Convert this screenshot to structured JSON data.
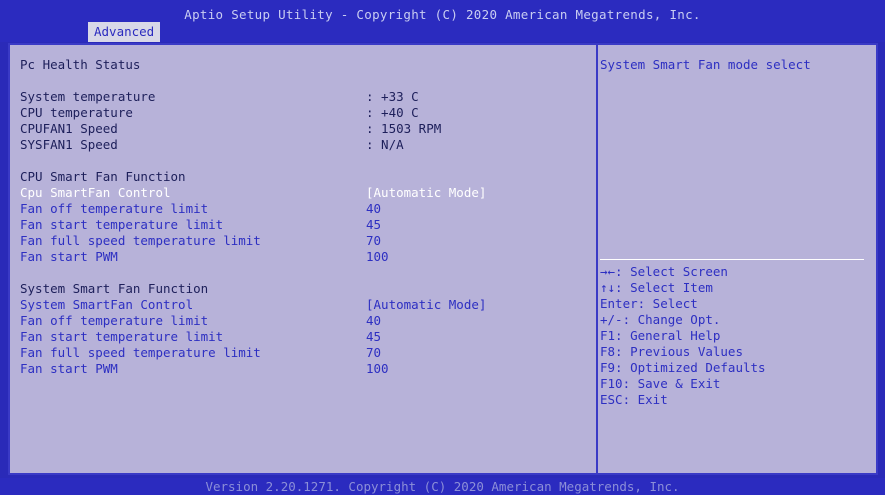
{
  "header": {
    "title": "Aptio Setup Utility - Copyright (C) 2020 American Megatrends, Inc.",
    "tab": "Advanced"
  },
  "page_title": "Pc Health Status",
  "monitor": [
    {
      "label": "System temperature",
      "value": ": +33 C"
    },
    {
      "label": "CPU temperature",
      "value": ": +40 C"
    },
    {
      "label": "CPUFAN1 Speed",
      "value": ": 1503 RPM"
    },
    {
      "label": "SYSFAN1 Speed",
      "value": ": N/A"
    }
  ],
  "cpu_fan": {
    "heading": "CPU Smart Fan Function",
    "control_label": "Cpu SmartFan Control",
    "control_value": "[Automatic Mode]",
    "items": [
      {
        "label": "Fan off temperature limit",
        "value": "40"
      },
      {
        "label": "Fan start temperature limit",
        "value": "45"
      },
      {
        "label": "Fan full speed temperature limit",
        "value": "70"
      },
      {
        "label": "Fan start PWM",
        "value": "100"
      }
    ]
  },
  "sys_fan": {
    "heading": "System Smart Fan Function",
    "control_label": "System SmartFan Control",
    "control_value": "[Automatic Mode]",
    "items": [
      {
        "label": "Fan off temperature limit",
        "value": "40"
      },
      {
        "label": "Fan start temperature limit",
        "value": "45"
      },
      {
        "label": "Fan full speed temperature limit",
        "value": "70"
      },
      {
        "label": "Fan start PWM",
        "value": "100"
      }
    ]
  },
  "help": {
    "text": "System Smart Fan mode select",
    "keys": [
      "→←: Select Screen",
      "↑↓: Select Item",
      "Enter: Select",
      "+/-: Change Opt.",
      "F1: General Help",
      "F8: Previous Values",
      "F9: Optimized Defaults",
      "F10: Save & Exit",
      "ESC: Exit"
    ]
  },
  "footer": {
    "version": "Version 2.20.1271. Copyright (C) 2020 American Megatrends, Inc."
  },
  "colors": {
    "background": "#2a2ab8",
    "panel": "#b7b2d9",
    "selectable_text": "#2d2fc2",
    "static_text": "#1d1f5a",
    "selected_text": "#ffffff"
  }
}
